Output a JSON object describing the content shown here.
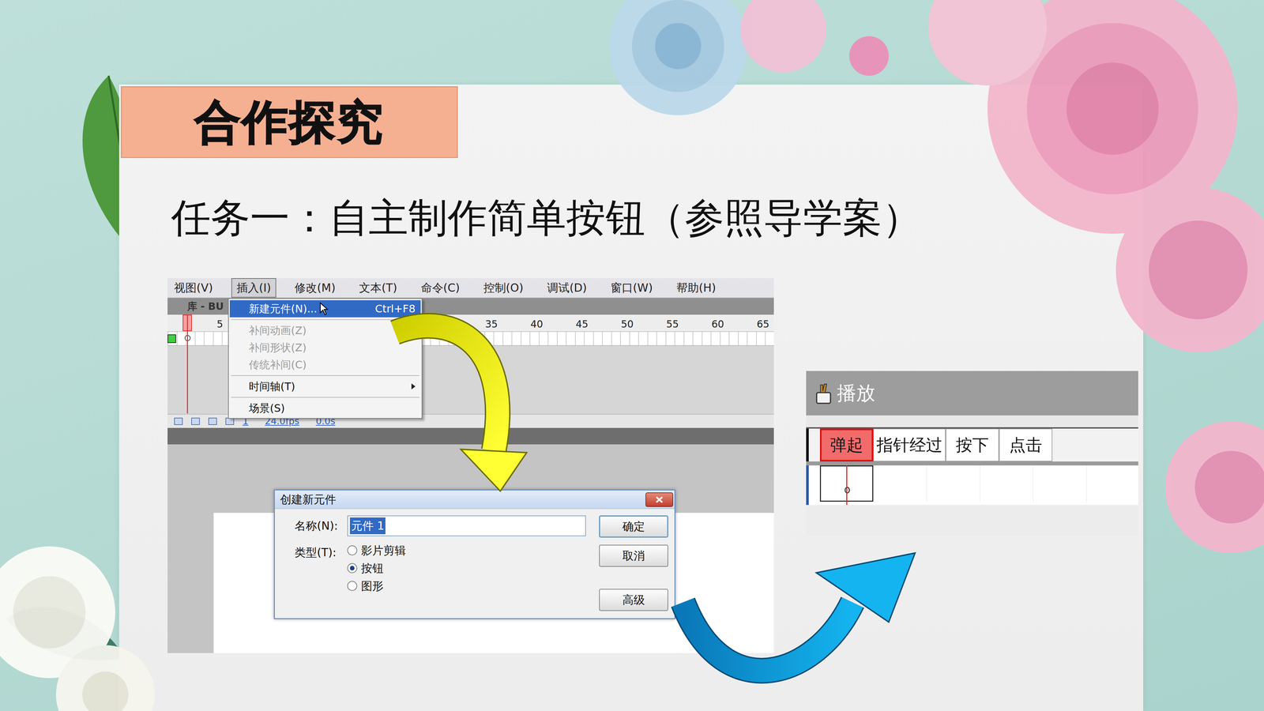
{
  "slide": {
    "title": "合作探究",
    "subtitle": "任务一：自主制作简单按钮（参照导学案）"
  },
  "flash": {
    "menubar": [
      {
        "label": "视图(V)",
        "selected": false
      },
      {
        "label": "插入(I)",
        "selected": true
      },
      {
        "label": "修改(M)",
        "selected": false
      },
      {
        "label": "文本(T)",
        "selected": false
      },
      {
        "label": "命令(C)",
        "selected": false
      },
      {
        "label": "控制(O)",
        "selected": false
      },
      {
        "label": "调试(D)",
        "selected": false
      },
      {
        "label": "窗口(W)",
        "selected": false
      },
      {
        "label": "帮助(H)",
        "selected": false
      }
    ],
    "panel_tab": "库 - BU",
    "ticks": [
      "5",
      "35",
      "40",
      "45",
      "50",
      "55",
      "60",
      "65"
    ],
    "status": {
      "frame": "1",
      "fps": "24.0fps",
      "time": "0.0s"
    },
    "menu": [
      [
        {
          "label": "新建元件(N)...",
          "shortcut": "Ctrl+F8",
          "selected": true,
          "disabled": false,
          "submenu": false
        }
      ],
      [
        {
          "label": "补间动画(Z)",
          "selected": false,
          "disabled": true,
          "submenu": false
        },
        {
          "label": "补间形状(Z)",
          "selected": false,
          "disabled": true,
          "submenu": false
        },
        {
          "label": "传统补间(C)",
          "selected": false,
          "disabled": true,
          "submenu": false
        }
      ],
      [
        {
          "label": "时间轴(T)",
          "selected": false,
          "disabled": false,
          "submenu": true
        }
      ],
      [
        {
          "label": "场景(S)",
          "selected": false,
          "disabled": false,
          "submenu": false
        }
      ]
    ],
    "dialog": {
      "title": "创建新元件",
      "name_label": "名称(N):",
      "name_value": "元件 1",
      "type_label": "类型(T):",
      "types": [
        {
          "label": "影片剪辑",
          "selected": false
        },
        {
          "label": "按钮",
          "selected": true
        },
        {
          "label": "图形",
          "selected": false
        }
      ],
      "buttons": [
        "确定",
        "取消",
        "高级"
      ]
    }
  },
  "player": {
    "title": "播放",
    "frames": [
      {
        "label": "弹起",
        "selected": true
      },
      {
        "label": "指针经过",
        "selected": false
      },
      {
        "label": "按下",
        "selected": false
      },
      {
        "label": "点击",
        "selected": false
      }
    ]
  }
}
